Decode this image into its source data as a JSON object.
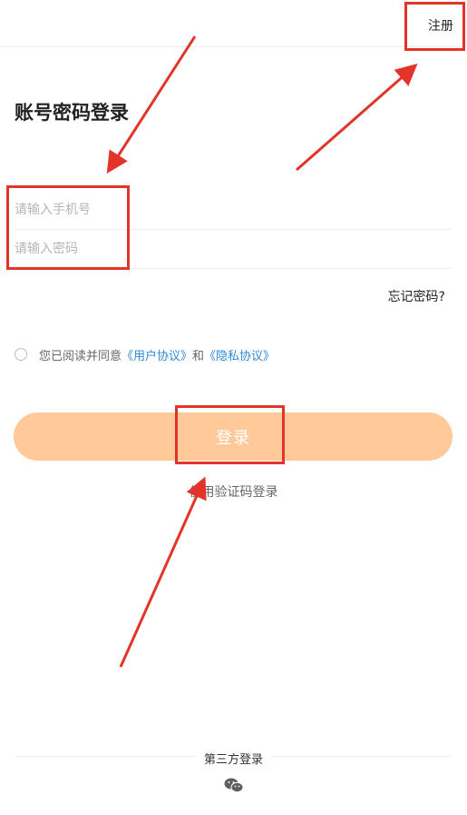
{
  "header": {
    "register_label": "注册"
  },
  "page": {
    "title": "账号密码登录"
  },
  "form": {
    "phone_placeholder": "请输入手机号",
    "password_placeholder": "请输入密码",
    "forgot_label": "忘记密码?"
  },
  "agreement": {
    "prefix": "您已阅读并同意",
    "user_agreement": "《用户协议》",
    "conjunction": "和",
    "privacy_agreement": "《隐私协议》",
    "checked": false
  },
  "login_button": {
    "label": "登录"
  },
  "sms_login_label": "使用验证码登录",
  "third_party": {
    "label": "第三方登录",
    "icons": [
      "wechat-icon"
    ]
  },
  "colors": {
    "accent_button": "#ffc99a",
    "link": "#2f88d8",
    "annotation": "#e3342a"
  }
}
